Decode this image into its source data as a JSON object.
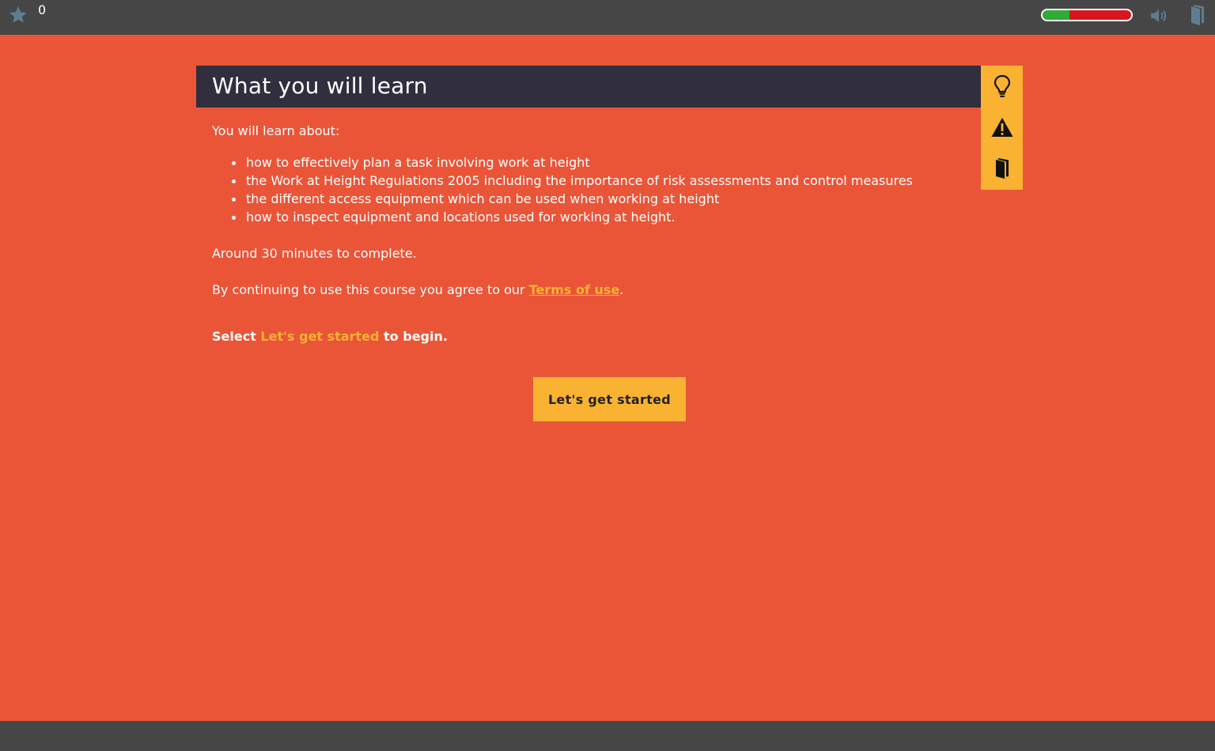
{
  "topbar": {
    "score": "0",
    "progress_fraction": 0.3,
    "icons": [
      "star-icon",
      "speaker-icon",
      "book-icon"
    ]
  },
  "header": {
    "title": "What you will learn"
  },
  "side_tools": [
    "lightbulb-icon",
    "warning-icon",
    "book-icon"
  ],
  "content": {
    "intro": "You will learn about:",
    "topics": [
      "how to effectively plan a task involving work at height",
      "the Work at Height Regulations 2005 including the importance of risk assessments and control measures",
      "the different access equipment which can be used when working at height",
      "how to inspect equipment and locations used for working at height."
    ],
    "duration": "Around 30 minutes to complete.",
    "agree_prefix": "By continuing to use this course you agree to our ",
    "terms_link": "Terms of use",
    "agree_suffix": ".",
    "instruction_prefix": "Select ",
    "instruction_highlight": "Let's get started",
    "instruction_suffix": " to begin."
  },
  "start_button_label": "Let's get started",
  "colors": {
    "background": "#ea5538",
    "bars": "#464646",
    "header": "#312e3e",
    "accent": "#f9b232",
    "progress_done": "#2fab36",
    "progress_remaining": "#d8151e"
  }
}
